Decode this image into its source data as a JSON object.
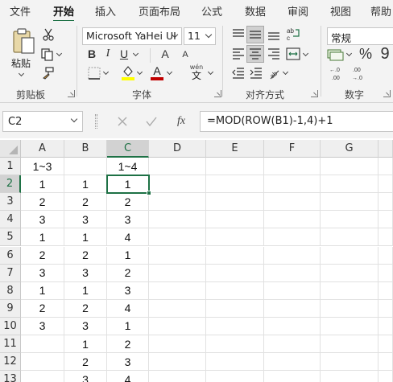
{
  "tabs": [
    "文件",
    "开始",
    "插入",
    "页面布局",
    "公式",
    "数据",
    "审阅",
    "视图",
    "帮助"
  ],
  "active_tab": "开始",
  "clipboard": {
    "paste_label": "粘贴",
    "group_label": "剪贴板"
  },
  "font": {
    "name": "Microsoft YaHei UI",
    "size": "11",
    "group_label": "字体",
    "bold": "B",
    "italic": "I",
    "underline": "U",
    "grow": "A",
    "shrink": "A",
    "phonetic_top": "wén",
    "phonetic_bottom": "文"
  },
  "alignment": {
    "group_label": "对齐方式"
  },
  "number": {
    "format": "常规",
    "group_label": "数字",
    "percent": "%",
    "comma": "9"
  },
  "formula_bar": {
    "name_box": "C2",
    "formula": "=MOD(ROW(B1)-1,4)+1",
    "fx": "fx"
  },
  "columns": [
    "A",
    "B",
    "C",
    "D",
    "E",
    "F",
    "G"
  ],
  "rows": [
    "1",
    "2",
    "3",
    "4",
    "5",
    "6",
    "7",
    "8",
    "9",
    "10",
    "11",
    "12",
    "13"
  ],
  "cells": [
    [
      "1~3",
      "",
      "1~4"
    ],
    [
      "1",
      "1",
      "1"
    ],
    [
      "2",
      "2",
      "2"
    ],
    [
      "3",
      "3",
      "3"
    ],
    [
      "1",
      "1",
      "4"
    ],
    [
      "2",
      "2",
      "1"
    ],
    [
      "3",
      "3",
      "2"
    ],
    [
      "1",
      "1",
      "3"
    ],
    [
      "2",
      "2",
      "4"
    ],
    [
      "3",
      "3",
      "1"
    ],
    [
      "",
      "1",
      "2"
    ],
    [
      "",
      "2",
      "3"
    ],
    [
      "",
      "3",
      "4"
    ]
  ],
  "selected_cell": "C2",
  "colors": {
    "accent": "#1e7145",
    "font_color": "#c00000",
    "highlight": "#ffff00"
  }
}
